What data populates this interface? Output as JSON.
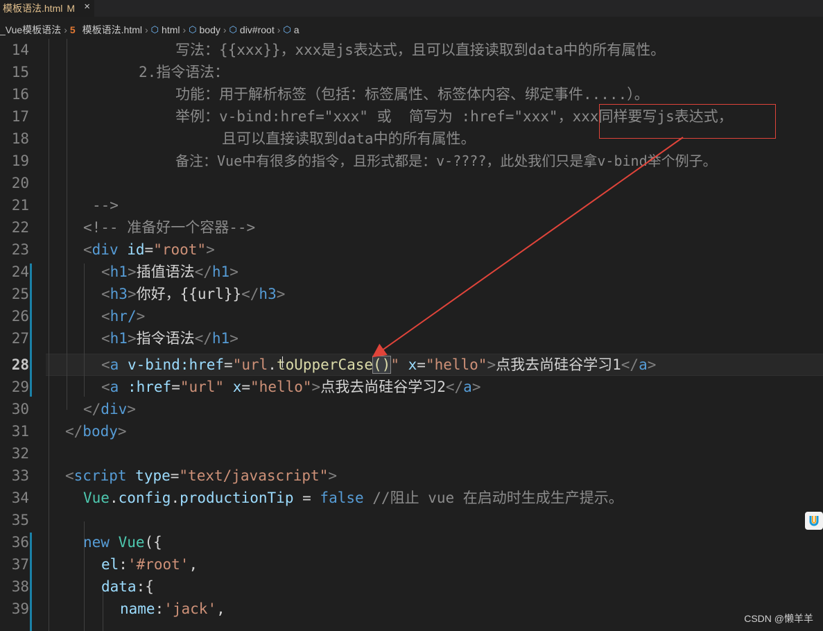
{
  "tab": {
    "filename": "模板语法.html",
    "status": "M",
    "close": "×"
  },
  "breadcrumb": [
    {
      "label": "_Vue模板语法"
    },
    {
      "label": "模板语法.html"
    },
    {
      "label": "html"
    },
    {
      "label": "body"
    },
    {
      "label": "div#root"
    },
    {
      "label": "a"
    }
  ],
  "gutter": [
    "14",
    "15",
    "16",
    "17",
    "18",
    "19",
    "20",
    "21",
    "22",
    "23",
    "24",
    "25",
    "26",
    "27",
    "28",
    "29",
    "30",
    "31",
    "32",
    "33",
    "34",
    "35",
    "36",
    "37",
    "38",
    "39"
  ],
  "code": {
    "l14": "写法：{{xxx}}，xxx是js表达式，且可以直接读取到data中的所有属性。",
    "l15": "2.指令语法：",
    "l16": "功能：用于解析标签（包括：标签属性、标签体内容、绑定事件.....）。",
    "l17a": "举例：v-bind:href=\"xxx\" 或  简写为 :href=\"xxx\"，",
    "l17b": "xxx同样要写js表达式，",
    "l18": "且可以直接读取到data中的所有属性。",
    "l19": "备注：Vue中有很多的指令，且形式都是：v-????，此处我们只是拿v-bind举个例子。",
    "l21": "-->",
    "l22": "<!-- 准备好一个容器-->",
    "l23": {
      "tag": "div",
      "attr": "id",
      "val": "\"root\""
    },
    "l24": {
      "tag": "h1",
      "text": "插值语法"
    },
    "l25": {
      "tag": "h3",
      "text": "你好，{{url}}"
    },
    "l26": {
      "tag": "hr/"
    },
    "l27": {
      "tag": "h1",
      "text": "指令语法"
    },
    "l28": {
      "tag": "a",
      "attr1": "v-bind:href",
      "val1a": "\"url",
      "val1b": ".",
      "val1c": "toUpperCase",
      "val1d": "()",
      "val1e": "\"",
      "attr2": "x",
      "val2": "\"hello\"",
      "text": "点我去尚硅谷学习1"
    },
    "l29": {
      "tag": "a",
      "attr1": ":href",
      "val1": "\"url\"",
      "attr2": "x",
      "val2": "\"hello\"",
      "text": "点我去尚硅谷学习2"
    },
    "l30": "div",
    "l31": "body",
    "l33": {
      "tag": "script",
      "attr": "type",
      "val": "\"text/javascript\""
    },
    "l34": {
      "obj": "Vue",
      "p1": "config",
      "p2": "productionTip",
      "op": " = ",
      "kw": "false",
      "comment": " //阻止 vue 在启动时生成生产提示。"
    },
    "l36": {
      "kw": "new",
      "obj": "Vue",
      "rest": "({"
    },
    "l37": {
      "key": "el",
      "val": "'#root'"
    },
    "l38": {
      "key": "data",
      "rest": ":{"
    },
    "l39": {
      "key": "name",
      "val": "'jack'"
    }
  },
  "watermark": "CSDN @懒羊羊",
  "colors": {
    "annotation": "#e0443a",
    "git_modified": "#1b81a8"
  }
}
